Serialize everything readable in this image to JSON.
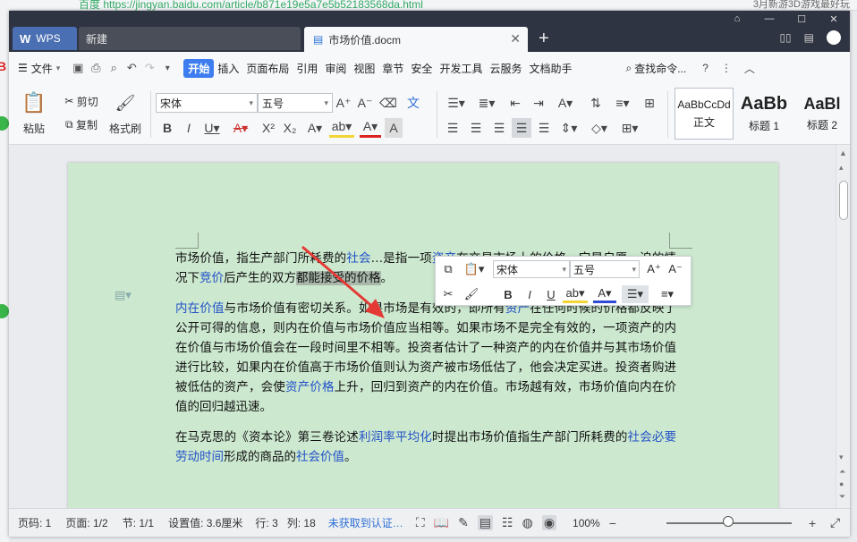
{
  "browser": {
    "url_text": "百度  https://jingyan.baidu.com/article/b871e19e5a7e5b52183568da.html",
    "right_text": "3月新游3D游戏最好玩"
  },
  "titlebar": {
    "wps_tab": "WPS",
    "new_tab": "新建",
    "doc_tab": "市场价值.docm"
  },
  "menu": {
    "file": "文件",
    "tabs": [
      "开始",
      "插入",
      "页面布局",
      "引用",
      "审阅",
      "视图",
      "章节",
      "安全",
      "开发工具",
      "云服务",
      "文档助手"
    ],
    "search": "查找命令..."
  },
  "ribbon": {
    "paste": "粘贴",
    "cut": "剪切",
    "copy": "复制",
    "format_painter": "格式刷",
    "font_name": "宋体",
    "font_size": "五号",
    "styles": [
      {
        "preview": "AaBbCcDd",
        "label": "正文"
      },
      {
        "preview": "AaBb",
        "label": "标题 1"
      },
      {
        "preview": "AaBl",
        "label": "标题 2"
      }
    ]
  },
  "mini_toolbar": {
    "font_name": "宋体",
    "font_size": "五号"
  },
  "document": {
    "p1": {
      "a": "市场价值，指生产部门所耗费的",
      "link1": "社会",
      "b": "…是指一项",
      "link2": "资产",
      "c": "在交易市场上的价格，它是自愿…迫的情况下",
      "link3": "竞价",
      "d": "后产生的双方",
      "sel": "都能接受的价格",
      "e": "。"
    },
    "p2": {
      "link1": "内在价值",
      "a": "与市场价值有密切关系。如果市场是有效的，即所有",
      "link2": "资产",
      "b": "在任何时候的价格都反映了公开可得的信息，则内在价值与市场价值应当相等。如果市场不是完全有效的，一项资产的内在价值与市场价值会在一段时间里不相等。投资者估计了一种资产的内在价值并与其市场价值进行比较，如果内在价值高于市场价值则认为资产被市场低估了，他会决定买进。投资者购进被低估的资产，会使",
      "link3": "资产价格",
      "c": "上升，回归到资产的内在价值。市场越有效，市场价值向内在价值的回归越迅速。"
    },
    "p3": {
      "a": "在马克思的《资本论》第三卷论述",
      "link1": "利润率平均化",
      "b": "时提出市场价值指生产部门所耗费的",
      "link2": "社会必要劳动时间",
      "c": "形成的商品的",
      "link3": "社会价值",
      "d": "。"
    }
  },
  "status": {
    "page_no": "页码: 1",
    "pages": "页面: 1/2",
    "section": "节: 1/1",
    "setting": "设置值: 3.6厘米",
    "row": "行: 3",
    "col": "列: 18",
    "cert": "未获取到认证…",
    "zoom": "100%"
  },
  "colors": {
    "titlebar": "#2f3442",
    "accent": "#3d7df0",
    "page_bg": "#cce8cf",
    "link": "#2352c8",
    "arrow": "#e53935"
  }
}
